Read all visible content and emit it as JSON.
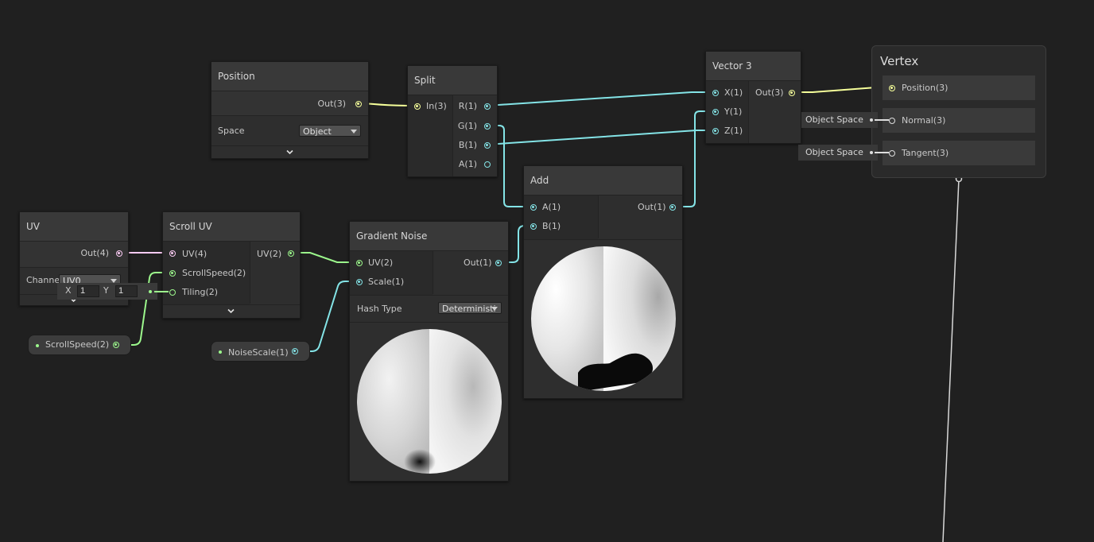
{
  "colors": {
    "canvas": "#202020",
    "node_body": "#2e2e2e",
    "node_title": "#393939",
    "port_float": "#84e4e7",
    "port_vec2": "#9cf88c",
    "port_vec3": "#f6ff9a",
    "port_vec4": "#fbcbf4"
  },
  "nodes": {
    "position": {
      "title": "Position",
      "out": "Out(3)",
      "space_label": "Space",
      "space_value": "Object"
    },
    "split": {
      "title": "Split",
      "in": "In(3)",
      "outs": [
        "R(1)",
        "G(1)",
        "B(1)",
        "A(1)"
      ]
    },
    "vector3": {
      "title": "Vector 3",
      "ins": [
        "X(1)",
        "Y(1)",
        "Z(1)"
      ],
      "out": "Out(3)"
    },
    "vertex": {
      "title": "Vertex",
      "slots": [
        "Position(3)",
        "Normal(3)",
        "Tangent(3)"
      ],
      "normal_space": "Object Space",
      "tangent_space": "Object Space"
    },
    "uv": {
      "title": "UV",
      "out": "Out(4)",
      "channel_label": "Channe",
      "channel_value": "UV0"
    },
    "scroll_uv": {
      "title": "Scroll UV",
      "ins": [
        "UV(4)",
        "ScrollSpeed(2)",
        "Tiling(2)"
      ],
      "out": "UV(2)",
      "tiling_x_label": "X",
      "tiling_x": "1",
      "tiling_y_label": "Y",
      "tiling_y": "1"
    },
    "gradient_noise": {
      "title": "Gradient Noise",
      "ins": [
        "UV(2)",
        "Scale(1)"
      ],
      "out": "Out(1)",
      "hash_label": "Hash Type",
      "hash_value": "Deterministi"
    },
    "add": {
      "title": "Add",
      "ins": [
        "A(1)",
        "B(1)"
      ],
      "out": "Out(1)"
    }
  },
  "properties": {
    "scroll_speed": "ScrollSpeed(2)",
    "noise_scale": "NoiseScale(1)"
  }
}
